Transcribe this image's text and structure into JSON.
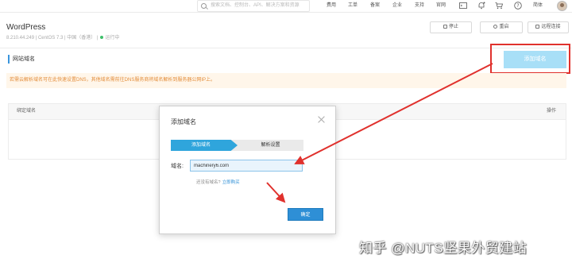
{
  "topnav": {
    "search_placeholder": "搜索文档、控制台、API、解决方案和资源",
    "items": [
      "费用",
      "工单",
      "备案",
      "企业",
      "支持",
      "官网"
    ],
    "lang": "简体"
  },
  "header": {
    "title": "WordPress",
    "subtitle_ip": "8.210.44.249",
    "subtitle_os": "CentOS 7.3",
    "subtitle_region": "中国（香港）",
    "status": "运行中",
    "buttons": {
      "stop": "停止",
      "restart": "重启",
      "remote": "远程连接"
    }
  },
  "section": {
    "title": "网站域名",
    "add_button": "添加域名",
    "notice": "若需云解析域名可在此快速设置DNS，其他域名需前往DNS服务商将域名解析到服务器公网IP上。"
  },
  "table": {
    "columns": [
      "绑定域名",
      "操作"
    ]
  },
  "modal": {
    "title": "添加域名",
    "steps": [
      "添加域名",
      "解析设置"
    ],
    "field_label": "域名:",
    "field_value": "machinery6.com",
    "hint_text": "还没有域名?",
    "hint_link": "立即购买",
    "confirm": "确定"
  },
  "colors": {
    "accent": "#2e8fd6",
    "annotation_red": "#e0312d",
    "step_active": "#2fa5dc",
    "notice_text": "#e38d3a",
    "status_green": "#3fbf6a"
  },
  "watermark": "知乎 @NUTS坚果外贸建站"
}
